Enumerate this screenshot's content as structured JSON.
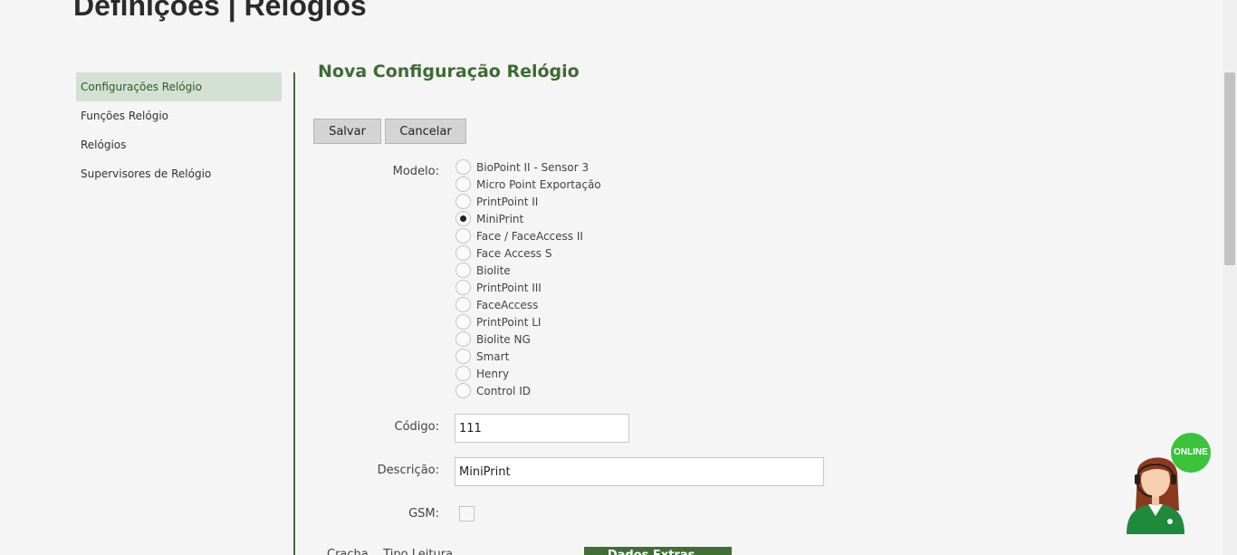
{
  "page": {
    "title": "Definições | Relógios"
  },
  "sidebar": {
    "items": [
      {
        "label": "Configurações Relógio",
        "active": true
      },
      {
        "label": "Funções Relógio",
        "active": false
      },
      {
        "label": "Relógios",
        "active": false
      },
      {
        "label": "Supervisores de Relógio",
        "active": false
      }
    ]
  },
  "form": {
    "title": "Nova Configuração Relógio",
    "save_label": "Salvar",
    "cancel_label": "Cancelar",
    "model_label": "Modelo:",
    "models": [
      "BioPoint II - Sensor 3",
      "Micro Point Exportação",
      "PrintPoint II",
      "MiniPrint",
      "Face / FaceAccess II",
      "Face Access S",
      "Biolite",
      "PrintPoint III",
      "FaceAccess",
      "PrintPoint LI",
      "Biolite NG",
      "Smart",
      "Henry",
      "Control ID"
    ],
    "selected_model": "MiniPrint",
    "code_label": "Código:",
    "code_value": "111",
    "description_label": "Descrição:",
    "description_value": "MiniPrint",
    "gsm_label": "GSM:",
    "gsm_checked": false,
    "partial_label": "Cracha... Tipo Leitura ... ",
    "partial_button": "Dados Extras..."
  },
  "chat": {
    "badge": "ONLINE"
  },
  "colors": {
    "accent": "#3e6b34",
    "online": "#3cc33c",
    "active_bg": "#d3e0d3"
  }
}
